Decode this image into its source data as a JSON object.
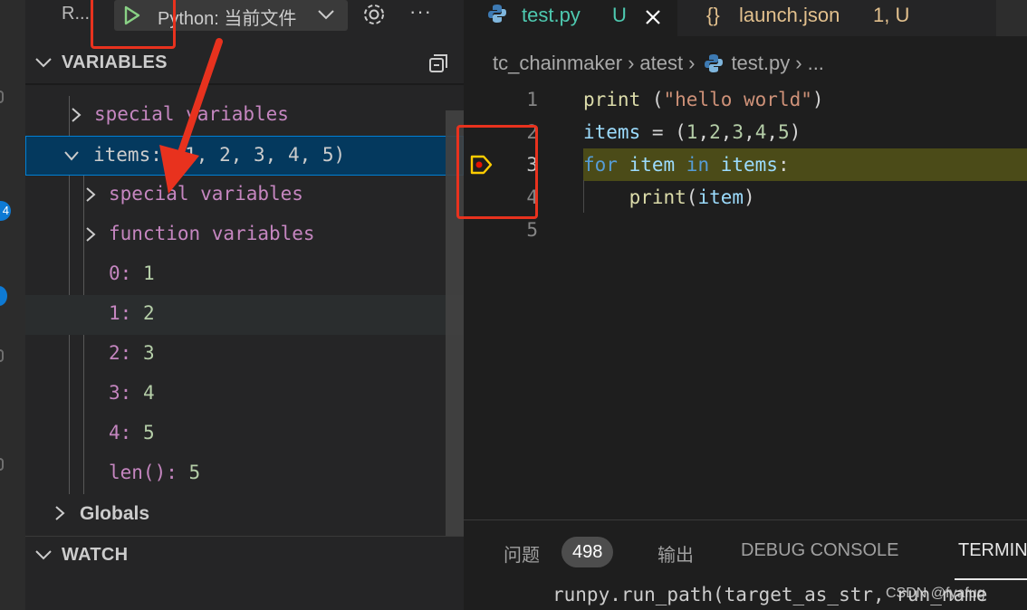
{
  "activity_bar": {
    "badges": [
      "4"
    ]
  },
  "debug_toolbar": {
    "run_label": "R...",
    "config_label": "Python: 当前文件",
    "more_label": "···"
  },
  "variables_section": {
    "title": "VARIABLES",
    "rows": [
      {
        "name": "special variables",
        "value": ""
      },
      {
        "name": "items:",
        "value": "(1, 2, 3, 4, 5)"
      },
      {
        "name": "special variables",
        "value": ""
      },
      {
        "name": "function variables",
        "value": ""
      },
      {
        "name": "0:",
        "value": "1"
      },
      {
        "name": "1:",
        "value": "2"
      },
      {
        "name": "2:",
        "value": "3"
      },
      {
        "name": "3:",
        "value": "4"
      },
      {
        "name": "4:",
        "value": "5"
      },
      {
        "name": "len():",
        "value": "5"
      }
    ],
    "globals_label": "Globals"
  },
  "watch_section": {
    "title": "WATCH"
  },
  "tabs": [
    {
      "name": "test.py",
      "status": "U"
    },
    {
      "name": "launch.json",
      "status": "1, U",
      "icon_text": "{}"
    }
  ],
  "breadcrumb": [
    "tc_chainmaker",
    "atest",
    "test.py",
    "..."
  ],
  "code": {
    "line_numbers": [
      "1",
      "2",
      "3",
      "4",
      "5"
    ]
  },
  "panel": {
    "tabs": [
      "问题",
      "输出",
      "DEBUG CONSOLE",
      "TERMIN"
    ],
    "problems_count": "498",
    "terminal_text": "runpy.run_path(target_as_str, run_name",
    "watermark": "CSDN @fyafug"
  },
  "colors": {
    "accent_blue": "#007fd4",
    "debug_highlight": "#4b4b18",
    "annotation_red": "#e8321e",
    "breakpoint_yellow": "#ffcc00"
  }
}
